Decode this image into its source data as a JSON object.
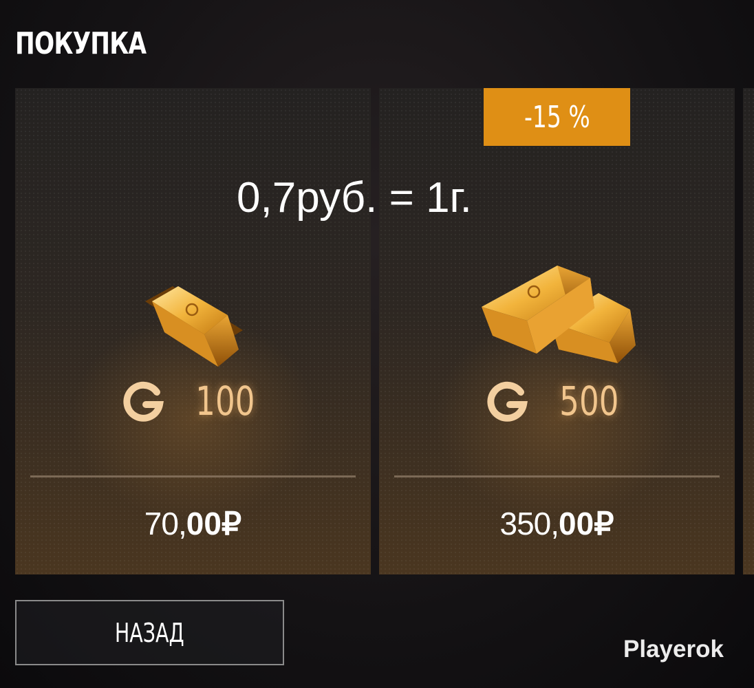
{
  "header": {
    "title": "ПОКУПКА"
  },
  "packs": [
    {
      "amount": "100",
      "price_main": "70,",
      "price_cents": "00",
      "currency": "₽",
      "art": "single-gold-bar"
    },
    {
      "amount": "500",
      "price_main": "350,",
      "price_cents": "00",
      "currency": "₽",
      "art": "two-gold-bars",
      "badge": "-15 %"
    }
  ],
  "overlay_note": "0,7руб. = 1г.",
  "footer": {
    "back_label": "НАЗАД",
    "watermark": "Playerok"
  },
  "colors": {
    "badge": "#df8f15",
    "gold_text": "#f1c58d",
    "text": "#ffffff"
  },
  "icons": {
    "currency": "gold-g-icon",
    "pack_1_art": "gold-bar-icon",
    "pack_2_art": "gold-bars-icon"
  }
}
